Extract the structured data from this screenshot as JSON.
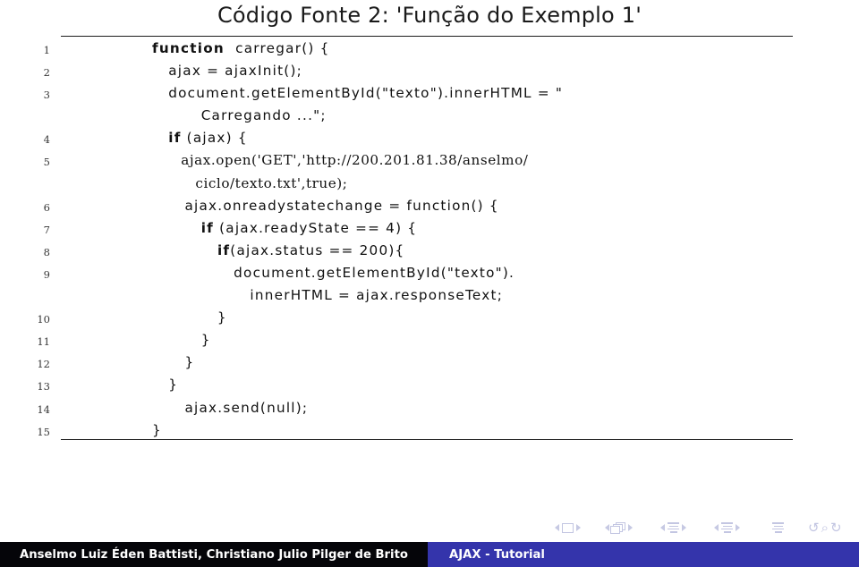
{
  "slide": {
    "title": "Código Fonte 2: 'Função do Exemplo 1'",
    "background_color": "#ffffff",
    "rule_color": "#1c1c1c"
  },
  "listing": {
    "lines": [
      {
        "number": "1",
        "text": "function  carregar() {",
        "style": "sans"
      },
      {
        "number": "2",
        "text": "   ajax = ajaxInit();",
        "style": "sans"
      },
      {
        "number": "3",
        "text": "   document.getElementById(\"texto\").innerHTML = \"",
        "style": "sans"
      },
      {
        "number": "",
        "text": "         Carregando ...\";",
        "style": "sans"
      },
      {
        "number": "4",
        "text": "   if (ajax) {",
        "style": "sans"
      },
      {
        "number": "5",
        "text": "      ajax.open('GET','http://200.201.81.38/anselmo/",
        "style": "serif"
      },
      {
        "number": "",
        "text": "         ciclo/texto.txt',true);",
        "style": "serif"
      },
      {
        "number": "6",
        "text": "      ajax.onreadystatechange = function() {",
        "style": "sans"
      },
      {
        "number": "7",
        "text": "         if (ajax.readyState == 4) {",
        "style": "sans"
      },
      {
        "number": "8",
        "text": "            if(ajax.status == 200){",
        "style": "sans"
      },
      {
        "number": "9",
        "text": "               document.getElementById(\"texto\").",
        "style": "sans"
      },
      {
        "number": "",
        "text": "                  innerHTML = ajax.responseText;",
        "style": "sans"
      },
      {
        "number": "10",
        "text": "            }",
        "style": "sans"
      },
      {
        "number": "11",
        "text": "         }",
        "style": "sans"
      },
      {
        "number": "12",
        "text": "      }",
        "style": "sans"
      },
      {
        "number": "13",
        "text": "   }",
        "style": "sans"
      },
      {
        "number": "14",
        "text": "      ajax.send(null);",
        "style": "sans"
      },
      {
        "number": "15",
        "text": "}",
        "style": "sans"
      }
    ]
  },
  "navigation": {
    "icons": [
      "slide-prev-icon",
      "slide-icon",
      "slide-next-icon",
      "frame-prev-icon",
      "frame-icon",
      "frame-next-icon",
      "subsection-prev-icon",
      "subsection-icon",
      "subsection-next-icon",
      "section-prev-icon",
      "section-icon",
      "section-next-icon",
      "doc-icon",
      "back-icon",
      "search-icon",
      "forward-icon"
    ],
    "back_glyph": "↺",
    "search_glyph": "⌕",
    "forward_glyph": "↻",
    "color": "#c3c6e2"
  },
  "footer": {
    "author": "Anselmo Luiz Éden Battisti, Christiano Julio Pilger de Brito",
    "title": "AJAX - Tutorial",
    "author_bg": "#050509",
    "title_bg": "#3434ab",
    "text_color": "#ffffff"
  }
}
